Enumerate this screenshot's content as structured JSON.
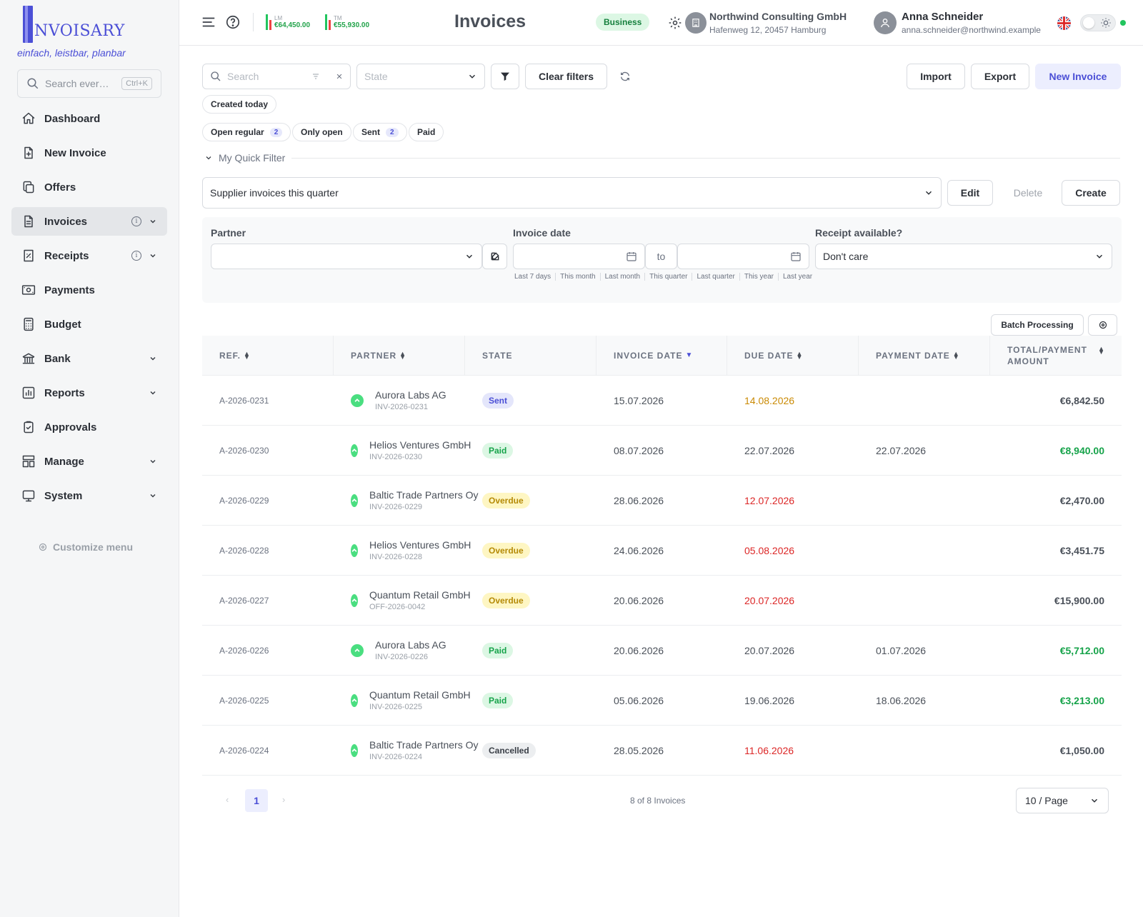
{
  "brand": {
    "logo_text": "NVOISARY",
    "tagline": "einfach, leistbar, planbar"
  },
  "sidebar": {
    "search_placeholder": "Search ever…",
    "shortcut": "Ctrl+K",
    "items": [
      {
        "label": "Dashboard",
        "icon": "home-icon"
      },
      {
        "label": "New Invoice",
        "icon": "file-plus-icon"
      },
      {
        "label": "Offers",
        "icon": "copy-icon"
      },
      {
        "label": "Invoices",
        "icon": "file-text-icon",
        "active": true,
        "info": true,
        "chevron": true
      },
      {
        "label": "Receipts",
        "icon": "receipt-icon",
        "info": true,
        "chevron": true
      },
      {
        "label": "Payments",
        "icon": "cash-icon"
      },
      {
        "label": "Budget",
        "icon": "calculator-icon"
      },
      {
        "label": "Bank",
        "icon": "bank-icon",
        "chevron": true
      },
      {
        "label": "Reports",
        "icon": "chart-icon",
        "chevron": true
      },
      {
        "label": "Approvals",
        "icon": "clipboard-check-icon"
      },
      {
        "label": "Manage",
        "icon": "layout-icon",
        "chevron": true
      },
      {
        "label": "System",
        "icon": "monitor-icon",
        "chevron": true
      }
    ],
    "customize_label": "Customize menu"
  },
  "topbar": {
    "kpi_lm_label": "LM",
    "kpi_lm_value": "€64,450.00",
    "kpi_tm_label": "TM",
    "kpi_tm_value": "€55,930.00",
    "title": "Invoices",
    "plan_badge": "Business",
    "company_name": "Northwind Consulting GmbH",
    "company_address": "Hafenweg 12, 20457 Hamburg",
    "user_name": "Anna Schneider",
    "user_email": "anna.schneider@northwind.example"
  },
  "toolbar": {
    "search_placeholder": "Search",
    "state_placeholder": "State",
    "clear_filters": "Clear filters",
    "import": "Import",
    "export": "Export",
    "new_invoice": "New Invoice"
  },
  "chips": {
    "created_today": "Created today",
    "open_regular": "Open regular",
    "open_regular_count": "2",
    "only_open": "Only open",
    "sent": "Sent",
    "sent_count": "2",
    "paid": "Paid"
  },
  "quick_filter": {
    "label": "My Quick Filter",
    "selected": "Supplier invoices this quarter",
    "edit": "Edit",
    "delete": "Delete",
    "create": "Create"
  },
  "filters": {
    "partner_label": "Partner",
    "date_label": "Invoice date",
    "date_to": "to",
    "date_presets": [
      "Last 7 days",
      "This month",
      "Last month",
      "This quarter",
      "Last quarter",
      "This year",
      "Last year"
    ],
    "receipt_label": "Receipt available?",
    "receipt_value": "Don't care"
  },
  "batch_label": "Batch Processing",
  "table": {
    "headers": {
      "ref": "REF.",
      "partner": "PARTNER",
      "state": "STATE",
      "invoice_date": "INVOICE DATE",
      "due_date": "DUE DATE",
      "payment_date": "PAYMENT DATE",
      "total_1": "TOTAL/PAYMENT",
      "total_2": "AMOUNT"
    },
    "rows": [
      {
        "ref": "A-2026-0231",
        "partner": "Aurora Labs AG",
        "number": "INV-2026-0231",
        "state": "Sent",
        "invoice_date": "15.07.2026",
        "due_date": "14.08.2026",
        "payment_date": "",
        "amount": "€6,842.50"
      },
      {
        "ref": "A-2026-0230",
        "partner": "Helios Ventures GmbH",
        "number": "INV-2026-0230",
        "state": "Paid",
        "invoice_date": "08.07.2026",
        "due_date": "22.07.2026",
        "payment_date": "22.07.2026",
        "amount": "€8,940.00"
      },
      {
        "ref": "A-2026-0229",
        "partner": "Baltic Trade Partners Oy",
        "number": "INV-2026-0229",
        "state": "Overdue",
        "invoice_date": "28.06.2026",
        "due_date": "12.07.2026",
        "payment_date": "",
        "amount": "€2,470.00"
      },
      {
        "ref": "A-2026-0228",
        "partner": "Helios Ventures GmbH",
        "number": "INV-2026-0228",
        "state": "Overdue",
        "invoice_date": "24.06.2026",
        "due_date": "05.08.2026",
        "payment_date": "",
        "amount": "€3,451.75"
      },
      {
        "ref": "A-2026-0227",
        "partner": "Quantum Retail GmbH",
        "number": "OFF-2026-0042",
        "state": "Overdue",
        "invoice_date": "20.06.2026",
        "due_date": "20.07.2026",
        "payment_date": "",
        "amount": "€15,900.00"
      },
      {
        "ref": "A-2026-0226",
        "partner": "Aurora Labs AG",
        "number": "INV-2026-0226",
        "state": "Paid",
        "invoice_date": "20.06.2026",
        "due_date": "20.07.2026",
        "payment_date": "01.07.2026",
        "amount": "€5,712.00"
      },
      {
        "ref": "A-2026-0225",
        "partner": "Quantum Retail GmbH",
        "number": "INV-2026-0225",
        "state": "Paid",
        "invoice_date": "05.06.2026",
        "due_date": "19.06.2026",
        "payment_date": "18.06.2026",
        "amount": "€3,213.00"
      },
      {
        "ref": "A-2026-0224",
        "partner": "Baltic Trade Partners Oy",
        "number": "INV-2026-0224",
        "state": "Cancelled",
        "invoice_date": "28.05.2026",
        "due_date": "11.06.2026",
        "payment_date": "",
        "amount": "€1,050.00"
      }
    ]
  },
  "pagination": {
    "current": "1",
    "summary": "8 of 8 Invoices",
    "page_size": "10 / Page"
  },
  "colors": {
    "accent": "#4b4fd6",
    "paid_amount": "#16a34a",
    "due_warn": "#ca8a04",
    "due_overdue": "#dc2626"
  }
}
